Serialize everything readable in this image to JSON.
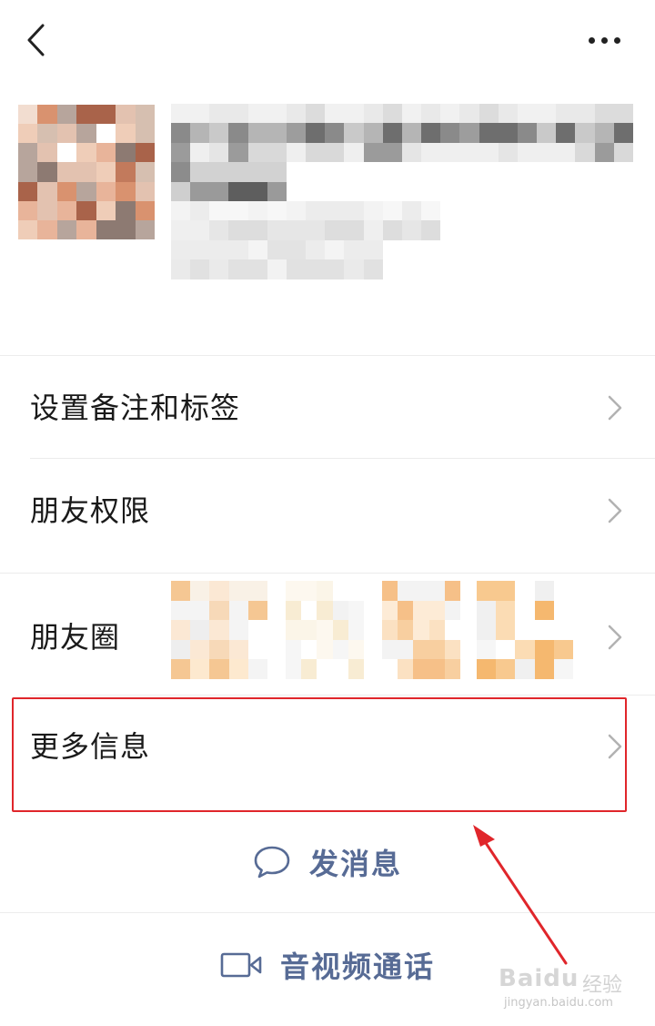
{
  "nav": {
    "back_icon": "chevron-left-icon",
    "more_icon": "more-dots-icon"
  },
  "menu": [
    {
      "label": "设置备注和标签"
    },
    {
      "label": "朋友权限"
    },
    {
      "label": "朋友圈"
    },
    {
      "label": "更多信息"
    }
  ],
  "actions": [
    {
      "label": "发消息",
      "icon": "chat-bubble-icon"
    },
    {
      "label": "音视频通话",
      "icon": "video-call-icon"
    }
  ],
  "colors": {
    "link": "#576b95",
    "highlight_border": "#e0262b",
    "divider": "#ececec",
    "chevron": "#b2b2b2"
  },
  "watermark": {
    "logo": "Baidu",
    "sub": "经验",
    "url": "jingyan.baidu.com"
  }
}
